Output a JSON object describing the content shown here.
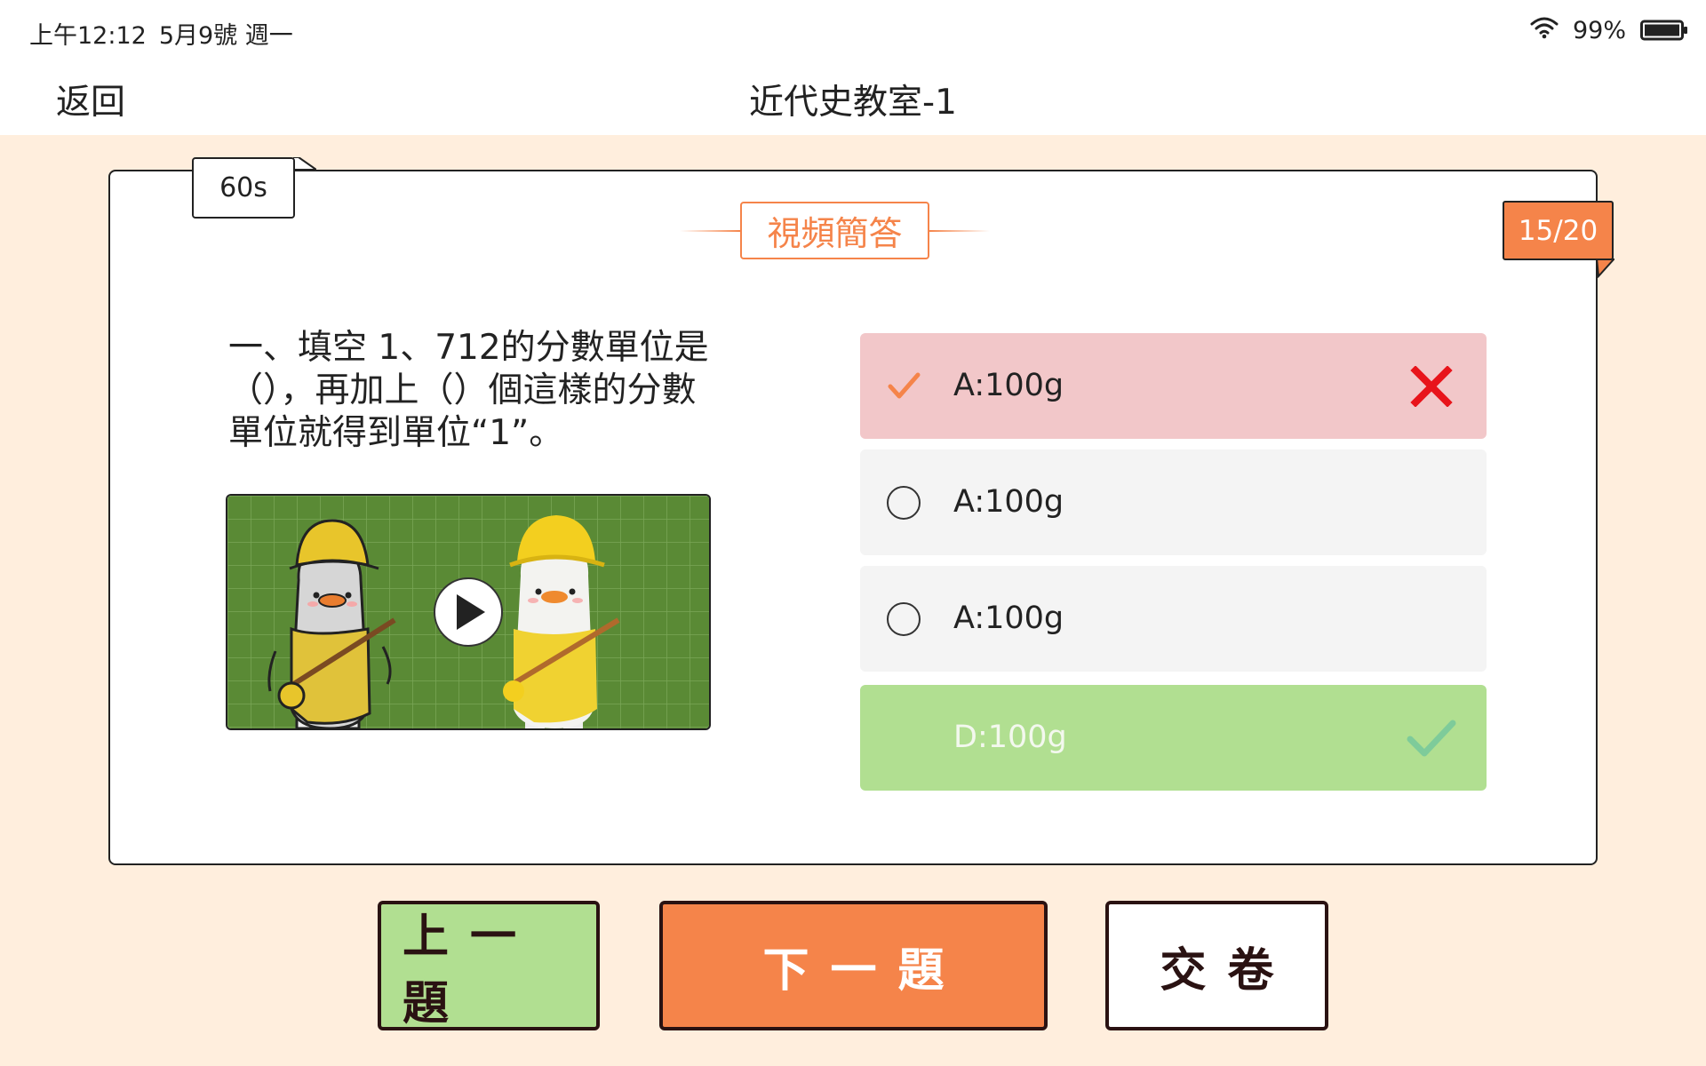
{
  "status_bar": {
    "time": "上午12:12",
    "date": "5月9號 週一",
    "battery": "99%"
  },
  "nav": {
    "back_label": "返回",
    "title": "近代史教室-1"
  },
  "quiz": {
    "timer": "60s",
    "progress": "15/20",
    "question_type": "視頻簡答",
    "question_text": "一、填空 1、712的分數單位是（），再加上（）個這樣的分數單位就得到單位“1”。",
    "options": [
      {
        "label": "A:100g",
        "state": "selected-wrong"
      },
      {
        "label": "A:100g",
        "state": "unselected"
      },
      {
        "label": "A:100g",
        "state": "unselected"
      },
      {
        "label": "D:100g",
        "state": "correct"
      }
    ]
  },
  "buttons": {
    "prev": "上一題",
    "next": "下一題",
    "submit": "交卷"
  },
  "colors": {
    "accent": "#f5844a",
    "wrong_bg": "#f2c7c9",
    "correct_bg": "#b1df91",
    "page_bg": "#ffeedd",
    "wrong_mark": "#e8141b",
    "correct_mark": "#7ecb9a"
  }
}
